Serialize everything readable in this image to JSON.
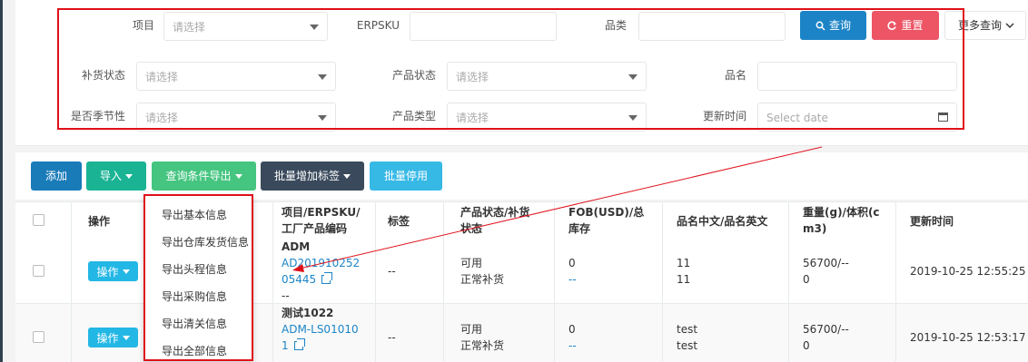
{
  "filters": {
    "row1": {
      "project_label": "项目",
      "project_placeholder": "请选择",
      "erpsku_label": "ERPSKU",
      "category_label": "品类",
      "query_button": "查询",
      "reset_button": "重置",
      "more_query_button": "更多查询"
    },
    "row2": {
      "restock_label": "补货状态",
      "restock_placeholder": "请选择",
      "product_status_label": "产品状态",
      "product_status_placeholder": "请选择",
      "product_name_label": "品名"
    },
    "row3": {
      "seasonal_label": "是否季节性",
      "seasonal_placeholder": "请选择",
      "product_type_label": "产品类型",
      "product_type_placeholder": "请选择",
      "update_time_label": "更新时间",
      "update_time_placeholder": "Select date"
    }
  },
  "toolbar": {
    "add": "添加",
    "import": "导入",
    "export_by_query": "查询条件导出",
    "batch_add_tag": "批量增加标签",
    "batch_disable": "批量停用"
  },
  "export_menu": {
    "items": [
      "导出基本信息",
      "导出仓库发货信息",
      "导出头程信息",
      "导出采购信息",
      "导出清关信息",
      "导出全部信息"
    ]
  },
  "table": {
    "headers": {
      "operation": "操作",
      "project_sku": [
        "项目/ERPSKU/",
        "工厂产品编码"
      ],
      "tags": "标签",
      "status": [
        "产品状态/补货",
        "状态"
      ],
      "fob": [
        "FOB(USD)/总",
        "库存"
      ],
      "names": "品名中文/品名英文",
      "weight": [
        "重量(g)/体积(c",
        "m3)"
      ],
      "update_time": "更新时间"
    },
    "rows": [
      {
        "op": "操作",
        "project": "ADM",
        "sku_lines": [
          "AD201910252",
          "05445"
        ],
        "factory_code": "--",
        "tags": "--",
        "status": "可用",
        "restock": "正常补货",
        "fob": "0",
        "stock": "--",
        "name_cn": "11",
        "name_en": "11",
        "weight": "56700/--",
        "volume": "0",
        "updated": "2019-10-25 12:55:25"
      },
      {
        "op": "操作",
        "project": "测试1022",
        "sku_lines": [
          "ADM-LS01010",
          "1"
        ],
        "tags": "--",
        "status": "可用",
        "restock": "正常补货",
        "fob": "0",
        "stock": "--",
        "name_cn": "test",
        "name_en": "test",
        "weight": "56700/--",
        "volume": "0",
        "updated": "2019-10-25 12:53:17"
      }
    ]
  },
  "colors": {
    "annotation_red": "#e0101a",
    "query_blue": "#1c84c6",
    "reset_red": "#ed5565"
  }
}
